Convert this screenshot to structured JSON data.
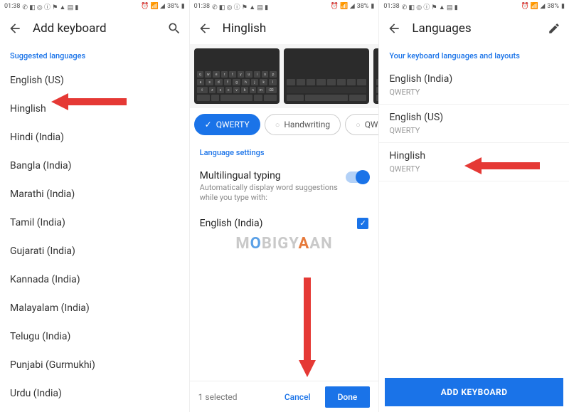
{
  "status": {
    "time": "01:38",
    "battery": "38%"
  },
  "panel1": {
    "title": "Add keyboard",
    "section": "Suggested languages",
    "languages": [
      "English (US)",
      "Hinglish",
      "Hindi (India)",
      "Bangla (India)",
      "Marathi (India)",
      "Tamil (India)",
      "Gujarati (India)",
      "Kannada (India)",
      "Malayalam (India)",
      "Telugu (India)",
      "Punjabi (Gurmukhi)",
      "Urdu (India)"
    ]
  },
  "panel2": {
    "title": "Hinglish",
    "chips": {
      "qwerty": "QWERTY",
      "handwriting": "Handwriting",
      "qwer": "QWER"
    },
    "section": "Language settings",
    "multilingual": {
      "title": "Multilingual typing",
      "sub": "Automatically display word suggestions while you type with:"
    },
    "extra_lang": "English (India)",
    "selected_count": "1 selected",
    "cancel": "Cancel",
    "done": "Done"
  },
  "panel3": {
    "title": "Languages",
    "section": "Your keyboard languages and layouts",
    "items": [
      {
        "name": "English (India)",
        "layout": "QWERTY"
      },
      {
        "name": "English (US)",
        "layout": "QWERTY"
      },
      {
        "name": "Hinglish",
        "layout": "QWERTY"
      }
    ],
    "add_btn": "ADD KEYBOARD"
  },
  "watermark": {
    "pre": "M",
    "o1": "O",
    "mid": "BIGY",
    "o2": "A",
    "post": "AN"
  }
}
